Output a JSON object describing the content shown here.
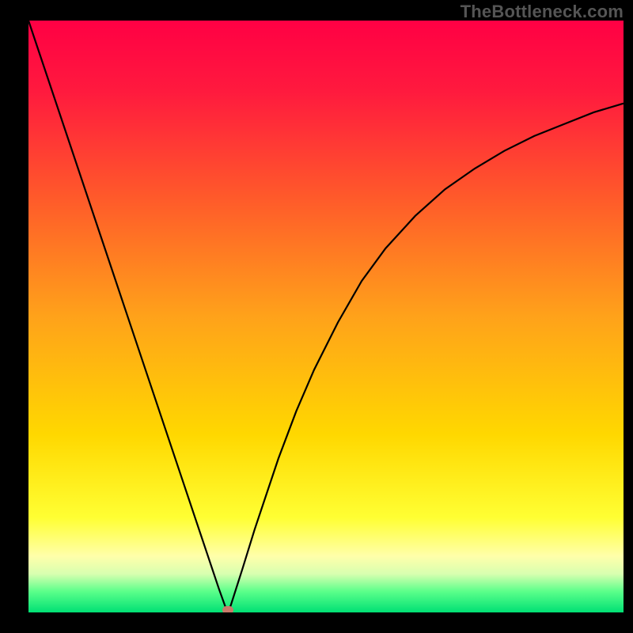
{
  "watermark": "TheBottleneck.com",
  "chart_data": {
    "type": "line",
    "title": "",
    "xlabel": "",
    "ylabel": "",
    "x": [
      0.0,
      0.02,
      0.04,
      0.06,
      0.08,
      0.1,
      0.12,
      0.14,
      0.16,
      0.18,
      0.2,
      0.22,
      0.24,
      0.26,
      0.28,
      0.3,
      0.31,
      0.32,
      0.33,
      0.335,
      0.34,
      0.36,
      0.38,
      0.4,
      0.42,
      0.45,
      0.48,
      0.52,
      0.56,
      0.6,
      0.65,
      0.7,
      0.75,
      0.8,
      0.85,
      0.9,
      0.95,
      1.0
    ],
    "y": [
      1.0,
      0.94,
      0.88,
      0.82,
      0.76,
      0.7,
      0.64,
      0.58,
      0.52,
      0.46,
      0.4,
      0.34,
      0.28,
      0.22,
      0.16,
      0.1,
      0.07,
      0.04,
      0.012,
      0.0,
      0.012,
      0.075,
      0.14,
      0.2,
      0.26,
      0.34,
      0.41,
      0.49,
      0.56,
      0.615,
      0.67,
      0.715,
      0.75,
      0.78,
      0.805,
      0.825,
      0.845,
      0.86
    ],
    "xlim": [
      0,
      1
    ],
    "ylim": [
      0,
      1
    ],
    "minimum_x": 0.335,
    "gradient_stops": [
      {
        "pos": 0.0,
        "color": "#ff0044"
      },
      {
        "pos": 0.12,
        "color": "#ff1a3e"
      },
      {
        "pos": 0.3,
        "color": "#ff5a2a"
      },
      {
        "pos": 0.5,
        "color": "#ffa21a"
      },
      {
        "pos": 0.7,
        "color": "#ffd800"
      },
      {
        "pos": 0.84,
        "color": "#ffff33"
      },
      {
        "pos": 0.905,
        "color": "#ffffaa"
      },
      {
        "pos": 0.935,
        "color": "#d8ffb0"
      },
      {
        "pos": 0.965,
        "color": "#5aff8a"
      },
      {
        "pos": 1.0,
        "color": "#00e074"
      }
    ],
    "marker_color": "#c97a6a",
    "curve_color": "#000000"
  }
}
